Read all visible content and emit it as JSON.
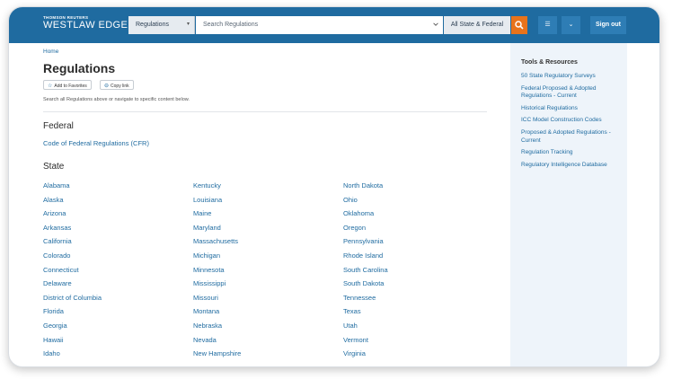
{
  "header": {
    "brand_top": "THOMSON REUTERS",
    "brand_name": "WESTLAW EDGE",
    "search_category": "Regulations",
    "search_placeholder": "Search Regulations",
    "jurisdiction": "All State & Federal",
    "sign_out": "Sign out",
    "colors": {
      "bar": "#1f6ba0",
      "search_button": "#e8731b"
    }
  },
  "breadcrumb": {
    "home": "Home"
  },
  "page": {
    "title": "Regulations",
    "add_to_favorites": "Add to Favorites",
    "copy_link": "Copy link",
    "hint": "Search all Regulations above or navigate to specific content below."
  },
  "federal": {
    "heading": "Federal",
    "links": [
      "Code of Federal Regulations (CFR)"
    ]
  },
  "state": {
    "heading": "State",
    "columns": [
      [
        "Alabama",
        "Alaska",
        "Arizona",
        "Arkansas",
        "California",
        "Colorado",
        "Connecticut",
        "Delaware",
        "District of Columbia",
        "Florida",
        "Georgia",
        "Hawaii",
        "Idaho"
      ],
      [
        "Kentucky",
        "Louisiana",
        "Maine",
        "Maryland",
        "Massachusetts",
        "Michigan",
        "Minnesota",
        "Mississippi",
        "Missouri",
        "Montana",
        "Nebraska",
        "Nevada",
        "New Hampshire"
      ],
      [
        "North Dakota",
        "Ohio",
        "Oklahoma",
        "Oregon",
        "Pennsylvania",
        "Rhode Island",
        "South Carolina",
        "South Dakota",
        "Tennessee",
        "Texas",
        "Utah",
        "Vermont",
        "Virginia"
      ]
    ]
  },
  "tools": {
    "heading": "Tools & Resources",
    "items": [
      "50 State Regulatory Surveys",
      "Federal Proposed & Adopted Regulations - Current",
      "Historical Regulations",
      "ICC Model Construction Codes",
      "Proposed & Adopted Regulations - Current",
      "Regulation Tracking",
      "Regulatory Intelligence Database"
    ]
  }
}
